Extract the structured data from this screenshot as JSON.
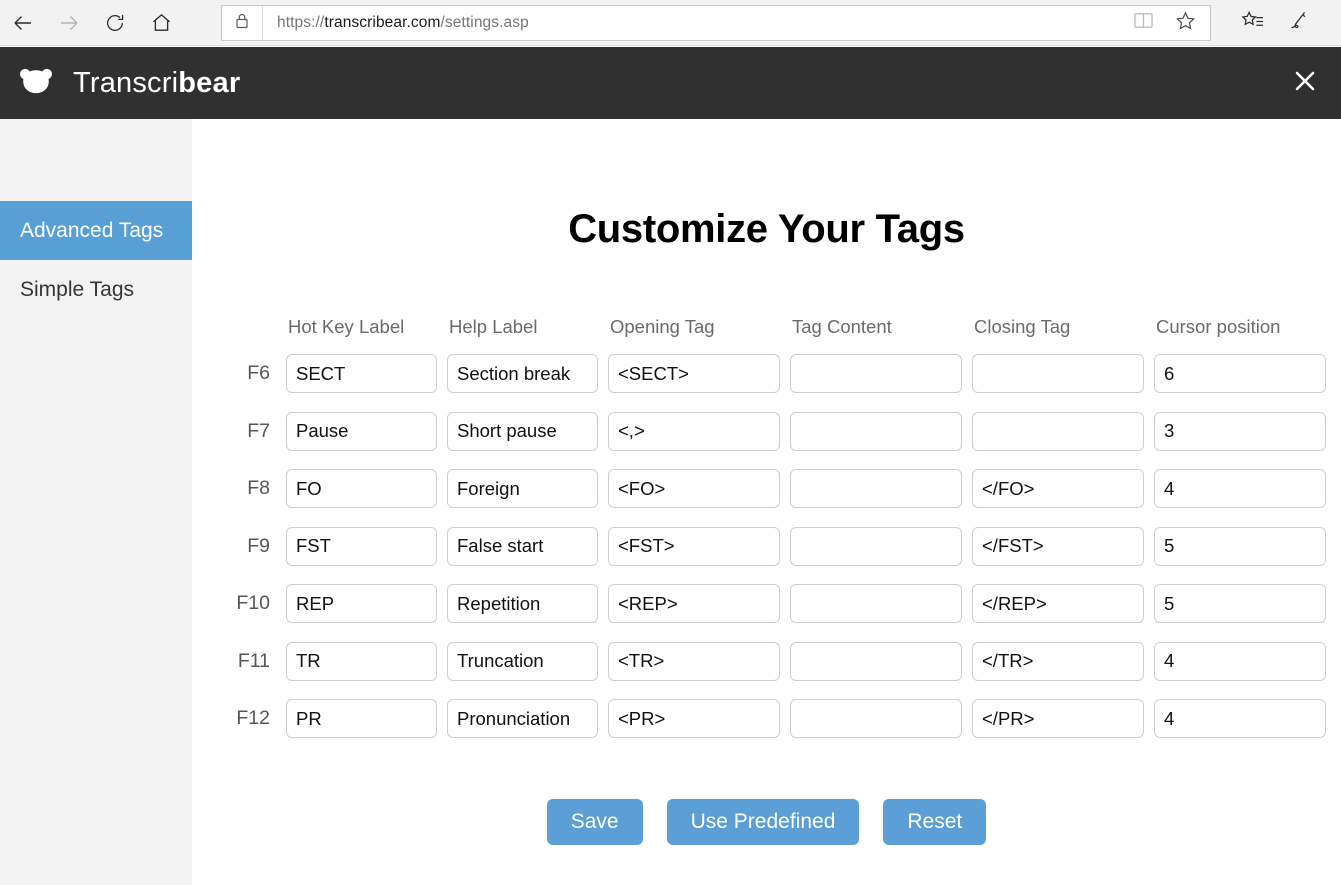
{
  "browser": {
    "nav": {
      "back": "back-arrow",
      "forward": "forward-arrow",
      "refresh": "refresh",
      "home": "home"
    },
    "address": {
      "lock_icon": "lock",
      "scheme": "https://",
      "host": "transcribear.com",
      "path": "/settings.asp",
      "reading_view_icon": "book",
      "favorite_icon": "star"
    },
    "toolbar": {
      "hub_icon": "star-with-lines",
      "notes_icon": "pen"
    }
  },
  "app": {
    "logo_icon": "bear-head",
    "brand_prefix": "Transcri",
    "brand_suffix": "bear",
    "close_label": "✕"
  },
  "sidebar": {
    "items": [
      {
        "label": "Advanced Tags",
        "active": true
      },
      {
        "label": "Simple Tags",
        "active": false
      }
    ]
  },
  "main": {
    "title": "Customize Your Tags",
    "columns": [
      "Hot Key Label",
      "Help Label",
      "Opening Tag",
      "Tag Content",
      "Closing Tag",
      "Cursor position"
    ],
    "rows": [
      {
        "hotkey": "F6",
        "hot_key_label": "SECT",
        "help_label": "Section break",
        "opening_tag": "<SECT>",
        "tag_content": "",
        "closing_tag": "",
        "cursor_position": "6"
      },
      {
        "hotkey": "F7",
        "hot_key_label": "Pause",
        "help_label": "Short pause",
        "opening_tag": "<,>",
        "tag_content": "",
        "closing_tag": "",
        "cursor_position": "3"
      },
      {
        "hotkey": "F8",
        "hot_key_label": "FO",
        "help_label": "Foreign",
        "opening_tag": "<FO>",
        "tag_content": "",
        "closing_tag": "</FO>",
        "cursor_position": "4"
      },
      {
        "hotkey": "F9",
        "hot_key_label": "FST",
        "help_label": "False start",
        "opening_tag": "<FST>",
        "tag_content": "",
        "closing_tag": "</FST>",
        "cursor_position": "5"
      },
      {
        "hotkey": "F10",
        "hot_key_label": "REP",
        "help_label": "Repetition",
        "opening_tag": "<REP>",
        "tag_content": "",
        "closing_tag": "</REP>",
        "cursor_position": "5"
      },
      {
        "hotkey": "F11",
        "hot_key_label": "TR",
        "help_label": "Truncation",
        "opening_tag": "<TR>",
        "tag_content": "",
        "closing_tag": "</TR>",
        "cursor_position": "4"
      },
      {
        "hotkey": "F12",
        "hot_key_label": "PR",
        "help_label": "Pronunciation",
        "opening_tag": "<PR>",
        "tag_content": "",
        "closing_tag": "</PR>",
        "cursor_position": "4"
      }
    ],
    "buttons": [
      {
        "label": "Save"
      },
      {
        "label": "Use Predefined"
      },
      {
        "label": "Reset"
      }
    ]
  },
  "colors": {
    "accent": "#589fd6",
    "header_bg": "#303030",
    "sidebar_bg": "#f3f3f3",
    "input_border": "#cfcfcf"
  }
}
